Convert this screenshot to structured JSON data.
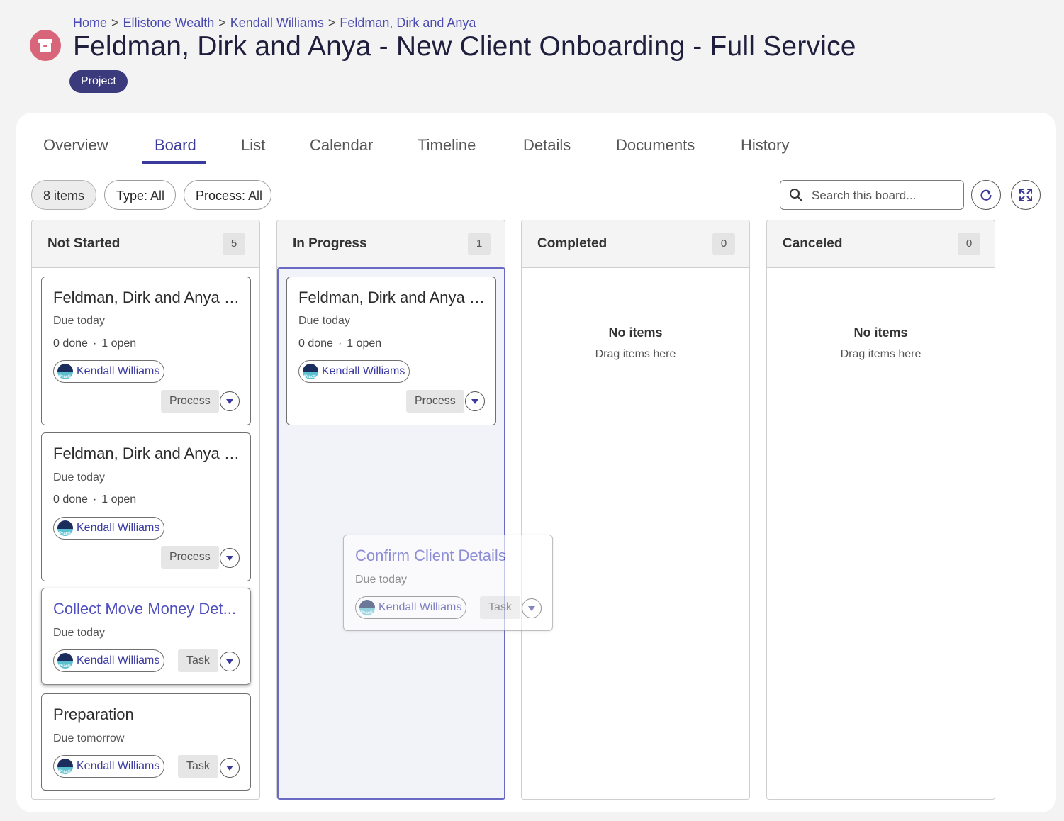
{
  "breadcrumb": [
    "Home",
    "Ellistone Wealth",
    "Kendall Williams",
    "Feldman, Dirk and Anya"
  ],
  "breadcrumb_separator": ">",
  "page_title": "Feldman, Dirk and Anya - New Client Onboarding - Full Service",
  "badge": "Project",
  "header_icon": "archive-box-icon",
  "tabs": [
    "Overview",
    "Board",
    "List",
    "Calendar",
    "Timeline",
    "Details",
    "Documents",
    "History"
  ],
  "active_tab": "Board",
  "filters": {
    "count": "8 items",
    "type_label": "Type:",
    "type_value": "All",
    "process_label": "Process:",
    "process_value": "All"
  },
  "search": {
    "placeholder": "Search this board..."
  },
  "colors": {
    "accent": "#3a3a9c",
    "badge_bg": "#3a3a7c",
    "header_icon": "#d9657a",
    "link": "#4f4fc0"
  },
  "columns": [
    {
      "title": "Not Started",
      "count": "5",
      "cards": [
        {
          "title": "Feldman, Dirk and Anya -...",
          "due": "Due today",
          "done": "0 done",
          "open": "1 open",
          "assignee": "Kendall Williams",
          "type": "Process"
        },
        {
          "title": "Feldman, Dirk and Anya -...",
          "due": "Due today",
          "done": "0 done",
          "open": "1 open",
          "assignee": "Kendall Williams",
          "type": "Process"
        },
        {
          "title": "Collect Move Money Det...",
          "due": "Due today",
          "assignee": "Kendall Williams",
          "type": "Task"
        },
        {
          "title": "Preparation",
          "due": "Due tomorrow",
          "assignee": "Kendall Williams",
          "type": "Task"
        }
      ]
    },
    {
      "title": "In Progress",
      "count": "1",
      "cards": [
        {
          "title": "Feldman, Dirk and Anya -...",
          "due": "Due today",
          "done": "0 done",
          "open": "1 open",
          "assignee": "Kendall Williams",
          "type": "Process"
        }
      ]
    },
    {
      "title": "Completed",
      "count": "0",
      "empty_title": "No items",
      "empty_sub": "Drag items here"
    },
    {
      "title": "Canceled",
      "count": "0",
      "empty_title": "No items",
      "empty_sub": "Drag items here"
    }
  ],
  "dragging_card": {
    "title": "Confirm Client Details",
    "due": "Due today",
    "assignee": "Kendall Williams",
    "type": "Task"
  },
  "progress_dot": "·",
  "avatar_text": "Practi"
}
